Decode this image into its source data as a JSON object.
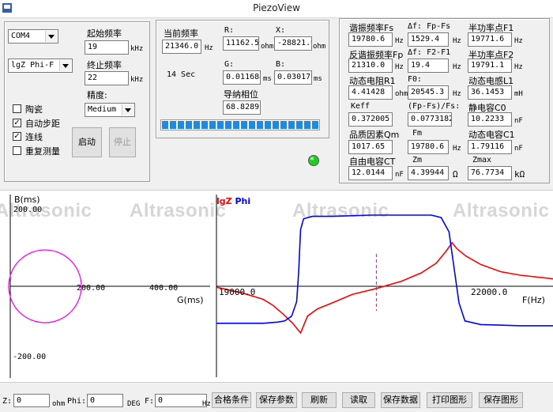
{
  "window": {
    "title": "PiezoView"
  },
  "left_panel": {
    "port_value": "COM4",
    "mode_value": "lgZ Phi-F",
    "start_freq_label": "起始频率",
    "start_freq_value": "19",
    "start_freq_unit": "kHz",
    "end_freq_label": "终止频率",
    "end_freq_value": "22",
    "end_freq_unit": "kHz",
    "precision_label": "精度:",
    "precision_value": "Medium",
    "ceramic_label": "陶瓷",
    "ceramic_checked": false,
    "auto_step_label": "自动步距",
    "auto_step_checked": true,
    "continuous_label": "连线",
    "continuous_checked": true,
    "repeat_label": "重复测量",
    "repeat_checked": false,
    "start_button": "启动",
    "stop_button": "停止"
  },
  "middle_panel": {
    "cur_freq_label": "当前频率",
    "cur_freq_value": "21346.0",
    "cur_freq_unit": "Hz",
    "r_label": "R:",
    "r_value": "11162.5",
    "r_unit": "ohm",
    "x_label": "X:",
    "x_value": "-28821.9",
    "x_unit": "ohm",
    "time_text": "14 Sec",
    "g_label": "G:",
    "g_value": "0.011684",
    "g_unit": "ms",
    "b_label": "B:",
    "b_value": "0.030170",
    "b_unit": "ms",
    "phase_label": "导纳相位",
    "phase_value": "68.8289",
    "progress_fraction": 1.0,
    "progress_segments": 20
  },
  "status_led_color": "#22cc22",
  "right_panel": {
    "fs_label": "谐振频率Fs",
    "fs_value": "19780.6",
    "fs_unit": "Hz",
    "df1_label": "Δf: Fp-Fs",
    "df1_value": "1529.4",
    "df1_unit": "Hz",
    "f1_label": "半功率点F1",
    "f1_value": "19771.6",
    "f1_unit": "Hz",
    "fp_label": "反谐振频率Fp",
    "fp_value": "21310.0",
    "fp_unit": "Hz",
    "df2_label": "Δf: F2-F1",
    "df2_value": "19.4",
    "df2_unit": "Hz",
    "f2_label": "半功率点F2",
    "f2_value": "19791.1",
    "f2_unit": "Hz",
    "r1_label": "动态电阻R1",
    "r1_value": "4.41428",
    "r1_unit": "ohm",
    "f0_label": "F0:",
    "f0_value": "20545.3",
    "f0_unit": "Hz",
    "l1_label": "动态电感L1",
    "l1_value": "36.1453",
    "l1_unit": "mH",
    "keff_label": "Keff",
    "keff_value": "0.372005",
    "fpfs_label": "(Fp-Fs)/Fs:",
    "fpfs_value": "0.0773182",
    "c0_label": "静电容C0",
    "c0_value": "10.2233",
    "c0_unit": "nF",
    "qm_label": "品质因素Qm",
    "qm_value": "1017.65",
    "fm_label": "Fm",
    "fm_value": "19780.6",
    "fm_unit": "Hz",
    "c1_label": "动态电容C1",
    "c1_value": "1.79116",
    "c1_unit": "nF",
    "ct_label": "自由电容CT",
    "ct_value": "12.0144",
    "ct_unit": "nF",
    "zm_label": "Zm",
    "zm_value": "4.39944",
    "zm_unit": "Ω",
    "zmax_label": "Zmax",
    "zmax_value": "76.7734",
    "zmax_unit": "kΩ"
  },
  "watermark": "Altrasonic",
  "admittance_chart": {
    "y_label": "B(ms)",
    "x_label": "G(ms)",
    "y_top_tick": "200.00",
    "y_bottom_tick": "-200.00",
    "x_ticks": [
      "200.00",
      "400.00"
    ],
    "circle_color": "#ff00ff"
  },
  "chart_data": {
    "type": "line",
    "title": "",
    "legend": [
      {
        "name": "lgZ",
        "color": "#ff0000"
      },
      {
        "name": "Phi",
        "color": "#0000ff"
      }
    ],
    "xlabel": "F(Hz)",
    "x_tick_labels": [
      "19000.0",
      "22000.0"
    ],
    "xlim": [
      18930,
      22330
    ],
    "grid": false,
    "series": [
      {
        "name": "lgZ",
        "color": "#ff0000",
        "ylim": [
          0,
          1
        ],
        "points": [
          [
            18930,
            0.38
          ],
          [
            19200,
            0.33
          ],
          [
            19400,
            0.28
          ],
          [
            19500,
            0.23
          ],
          [
            19600,
            0.16
          ],
          [
            19700,
            0.08
          ],
          [
            19760,
            0.02
          ],
          [
            19780,
            0.0
          ],
          [
            19800,
            0.04
          ],
          [
            19850,
            0.14
          ],
          [
            19950,
            0.2
          ],
          [
            20100,
            0.25
          ],
          [
            20300,
            0.32
          ],
          [
            20545,
            0.37
          ],
          [
            20800,
            0.43
          ],
          [
            21000,
            0.5
          ],
          [
            21150,
            0.58
          ],
          [
            21250,
            0.68
          ],
          [
            21310,
            0.75
          ],
          [
            21360,
            0.7
          ],
          [
            21450,
            0.64
          ],
          [
            21600,
            0.57
          ],
          [
            21800,
            0.51
          ],
          [
            22000,
            0.48
          ],
          [
            22330,
            0.45
          ]
        ]
      },
      {
        "name": "Phi",
        "color": "#0000ff",
        "ylim": [
          0,
          1
        ],
        "points": [
          [
            18930,
            0.08
          ],
          [
            19400,
            0.08
          ],
          [
            19550,
            0.09
          ],
          [
            19620,
            0.1
          ],
          [
            19690,
            0.14
          ],
          [
            19740,
            0.26
          ],
          [
            19760,
            0.5
          ],
          [
            19780,
            0.86
          ],
          [
            19810,
            0.95
          ],
          [
            19900,
            0.97
          ],
          [
            20100,
            0.97
          ],
          [
            20500,
            0.98
          ],
          [
            20900,
            0.98
          ],
          [
            21100,
            0.98
          ],
          [
            21200,
            0.96
          ],
          [
            21280,
            0.84
          ],
          [
            21320,
            0.6
          ],
          [
            21380,
            0.25
          ],
          [
            21440,
            0.1
          ],
          [
            21600,
            0.07
          ],
          [
            22000,
            0.06
          ],
          [
            22330,
            0.06
          ]
        ]
      }
    ],
    "marker_x": 20545.3
  },
  "bottom_bar": {
    "z_label": "Z:",
    "z_value": "0",
    "z_unit": "ohm",
    "phi_label": "Phi:",
    "phi_value": "0",
    "phi_unit": "DEG",
    "f_label": "F:",
    "f_value": "0",
    "f_unit": "Hz",
    "btn_pass": "合格条件",
    "btn_save_params": "保存参数",
    "btn_refresh": "刷新",
    "btn_read": "读取",
    "btn_save_data": "保存数据",
    "btn_print": "打印图形",
    "btn_save_graph": "保存图形"
  }
}
